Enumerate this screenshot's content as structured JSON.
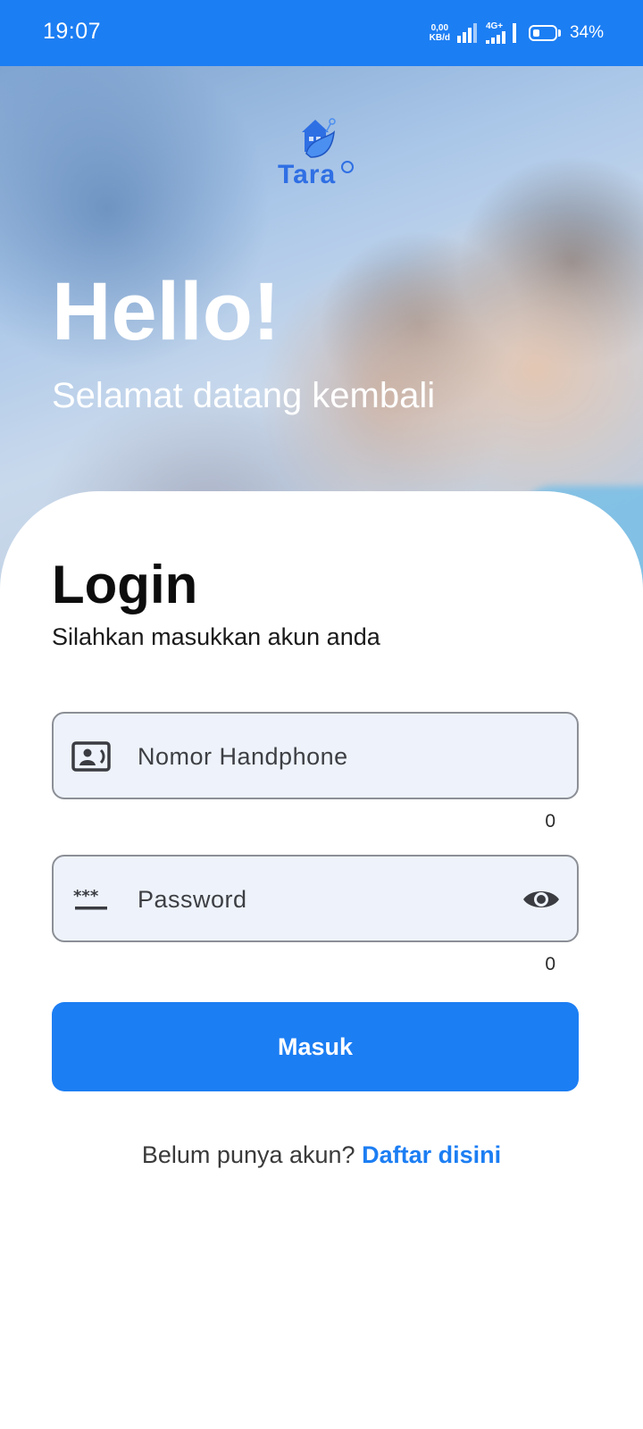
{
  "status_bar": {
    "time": "19:07",
    "net_speed_value": "0,00",
    "net_speed_unit": "KB/d",
    "network_type": "4G+",
    "battery_percent": "34%",
    "battery_level": 0.34
  },
  "hero": {
    "app_name": "Tara",
    "title": "Hello!",
    "subtitle": "Selamat datang kembali"
  },
  "login": {
    "title": "Login",
    "subtitle": "Silahkan masukkan akun anda",
    "phone_placeholder": "Nomor Handphone",
    "phone_counter": "0",
    "password_placeholder": "Password",
    "password_counter": "0",
    "submit_label": "Masuk",
    "signup_prompt": "Belum punya akun?",
    "signup_link": "Daftar disini"
  },
  "colors": {
    "primary": "#1c7ef3",
    "field_background": "#eef3fb",
    "field_border": "#8c8f96"
  }
}
